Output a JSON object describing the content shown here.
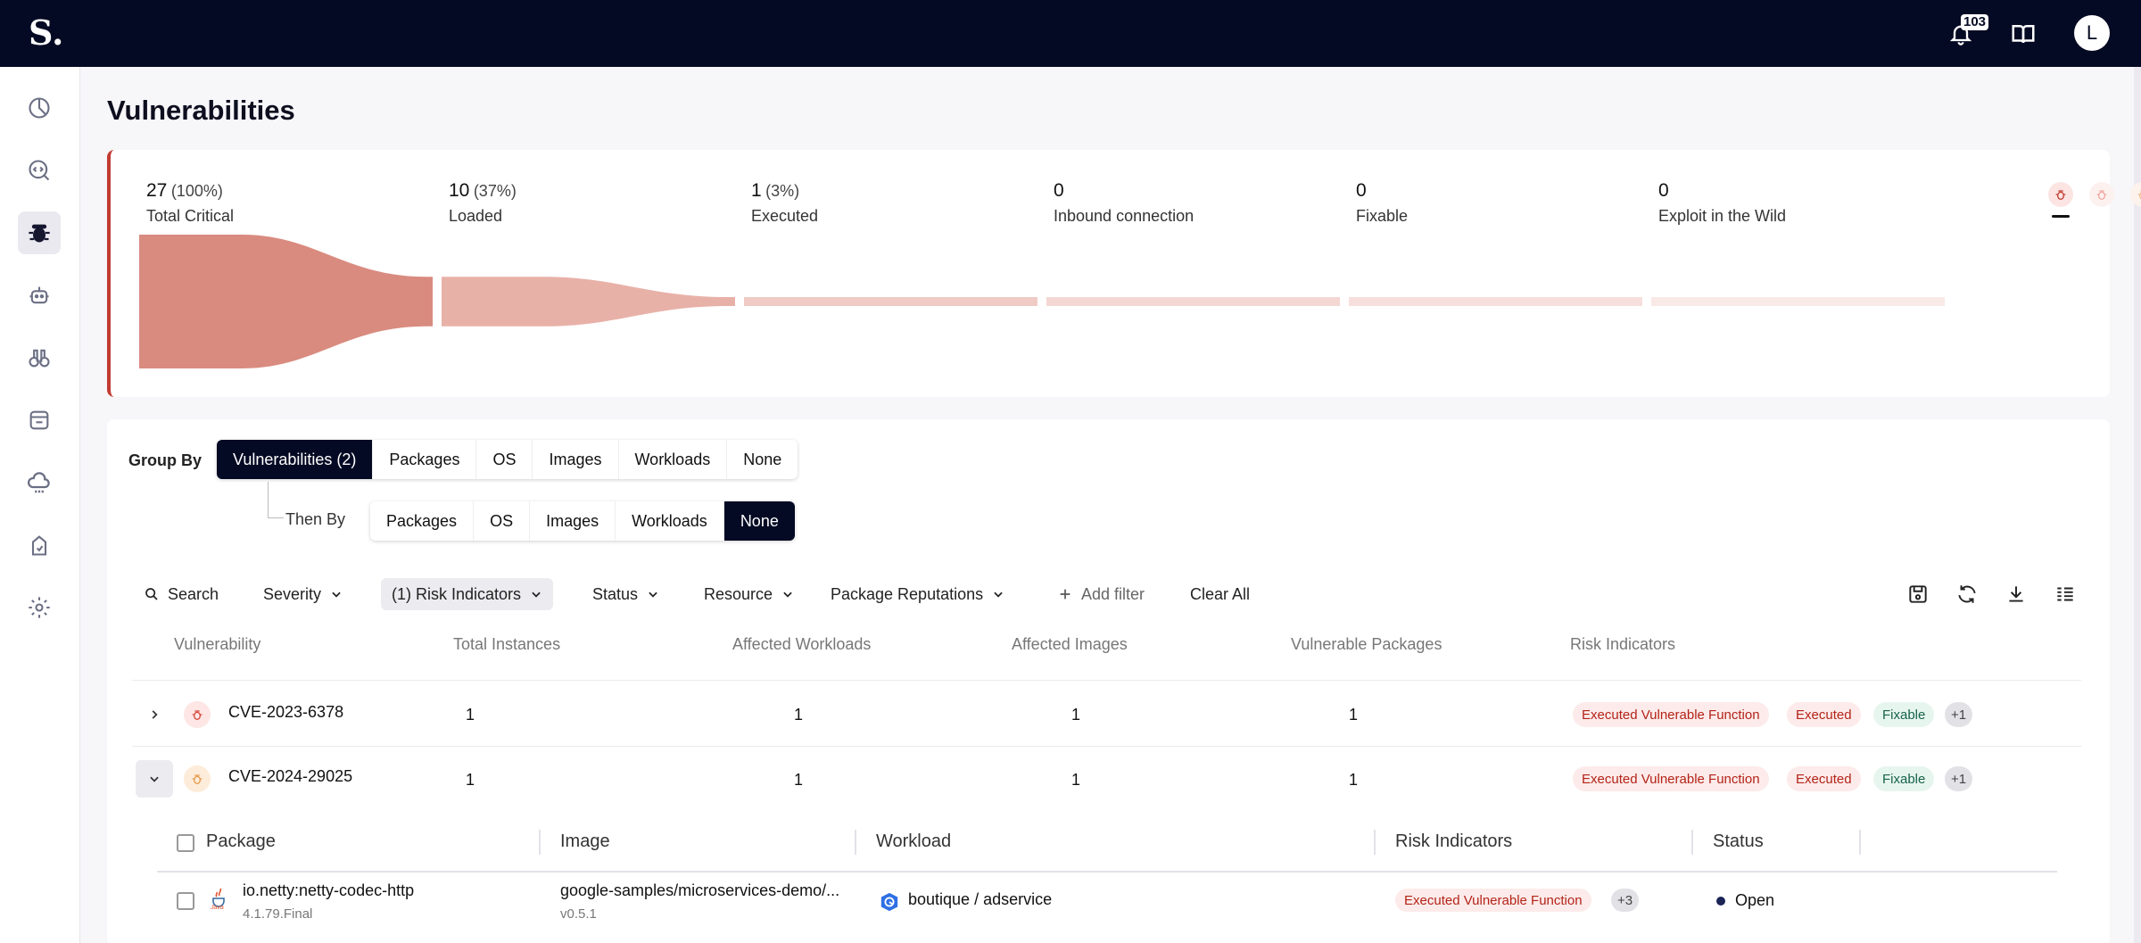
{
  "app": {
    "logo_text": "S.",
    "notifications_count": "103",
    "avatar_initial": "L"
  },
  "page": {
    "title": "Vulnerabilities"
  },
  "funnel": {
    "stages": [
      {
        "number": "27",
        "percent": "(100%)",
        "label": "Total Critical"
      },
      {
        "number": "10",
        "percent": "(37%)",
        "label": "Loaded"
      },
      {
        "number": "1",
        "percent": "(3%)",
        "label": "Executed"
      },
      {
        "number": "0",
        "percent": "",
        "label": "Inbound connection"
      },
      {
        "number": "0",
        "percent": "",
        "label": "Fixable"
      },
      {
        "number": "0",
        "percent": "",
        "label": "Exploit in the Wild"
      }
    ],
    "values": [
      27,
      10,
      1,
      0,
      0,
      0
    ],
    "colors": [
      "#d98b7f",
      "#e8b1a8",
      "#f0cbc5",
      "#f4d7d3",
      "#f6dfdc",
      "#f9e9e7"
    ]
  },
  "severity_icons": [
    {
      "name": "critical",
      "color": "#c23b32",
      "bg": "#fbe4e2"
    },
    {
      "name": "high",
      "color": "#f0a7a0",
      "bg": "#fdf1f0"
    },
    {
      "name": "medium",
      "color": "#f3b98a",
      "bg": "#fdf3ec"
    },
    {
      "name": "low",
      "color": "#8fcfa8",
      "bg": "#eef8f2"
    }
  ],
  "groupby": {
    "label": "Group By",
    "options": [
      "Vulnerabilities (2)",
      "Packages",
      "OS",
      "Images",
      "Workloads",
      "None"
    ],
    "then_label": "Then By",
    "then_options": [
      "Packages",
      "OS",
      "Images",
      "Workloads",
      "None"
    ]
  },
  "filters": {
    "search": "Search",
    "severity": "Severity",
    "risk": "(1) Risk Indicators",
    "status": "Status",
    "resource": "Resource",
    "package_reputations": "Package Reputations",
    "add_filter": "Add filter",
    "clear_all": "Clear All"
  },
  "table": {
    "headers": [
      "Vulnerability",
      "Total Instances",
      "Affected Workloads",
      "Affected Images",
      "Vulnerable Packages",
      "Risk Indicators"
    ],
    "rows": [
      {
        "cve": "CVE-2023-6378",
        "total": "1",
        "workloads": "1",
        "images": "1",
        "packages": "1",
        "risk": [
          "Executed Vulnerable Function",
          "Executed",
          "Fixable",
          "+1"
        ]
      },
      {
        "cve": "CVE-2024-29025",
        "total": "1",
        "workloads": "1",
        "images": "1",
        "packages": "1",
        "risk": [
          "Executed Vulnerable Function",
          "Executed",
          "Fixable",
          "+1"
        ]
      }
    ]
  },
  "subtable": {
    "headers": [
      "Package",
      "Image",
      "Workload",
      "Risk Indicators",
      "Status"
    ],
    "rows": [
      {
        "package": "io.netty:netty-codec-http",
        "package_version": "4.1.79.Final",
        "package_icon_text": "Java",
        "image": "google-samples/microservices-demo/...",
        "image_version": "v0.5.1",
        "workload": "boutique / adservice",
        "risk": "Executed Vulnerable Function",
        "risk_more": "+3",
        "status": "Open"
      }
    ]
  }
}
